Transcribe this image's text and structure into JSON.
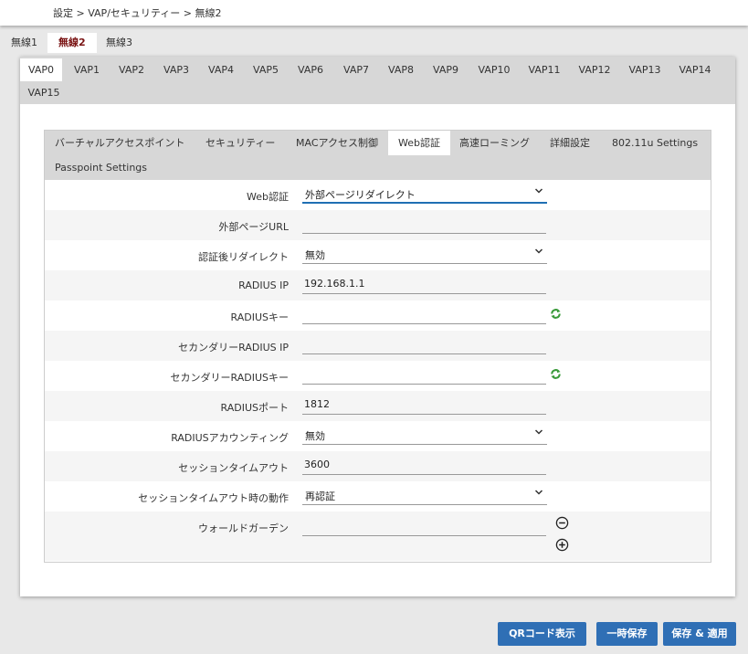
{
  "breadcrumb": "設定 > VAP/セキュリティー > 無線2",
  "radio_tabs": [
    "無線1",
    "無線2",
    "無線3"
  ],
  "active_radio": 1,
  "vap_tabs": [
    "VAP0",
    "VAP1",
    "VAP2",
    "VAP3",
    "VAP4",
    "VAP5",
    "VAP6",
    "VAP7",
    "VAP8",
    "VAP9",
    "VAP10",
    "VAP11",
    "VAP12",
    "VAP13",
    "VAP14",
    "VAP15"
  ],
  "active_vap": 0,
  "sub_tabs": [
    "バーチャルアクセスポイント",
    "セキュリティー",
    "MACアクセス制御",
    "Web認証",
    "高速ローミング",
    "詳細設定",
    "802.11u Settings",
    "Passpoint Settings"
  ],
  "active_sub_tab": 3,
  "form": {
    "web_auth": {
      "label": "Web認証",
      "value": "外部ページリダイレクト"
    },
    "external_url": {
      "label": "外部ページURL",
      "value": ""
    },
    "post_auth_redirect": {
      "label": "認証後リダイレクト",
      "value": "無効"
    },
    "radius_ip": {
      "label": "RADIUS IP",
      "value": "192.168.1.1"
    },
    "radius_key": {
      "label": "RADIUSキー",
      "value": ""
    },
    "secondary_radius_ip": {
      "label": "セカンダリーRADIUS IP",
      "value": ""
    },
    "secondary_radius_key": {
      "label": "セカンダリーRADIUSキー",
      "value": ""
    },
    "radius_port": {
      "label": "RADIUSポート",
      "value": "1812"
    },
    "radius_accounting": {
      "label": "RADIUSアカウンティング",
      "value": "無効"
    },
    "session_timeout": {
      "label": "セッションタイムアウト",
      "value": "3600"
    },
    "session_timeout_action": {
      "label": "セッションタイムアウト時の動作",
      "value": "再認証"
    },
    "walled_garden": {
      "label": "ウォールドガーデン",
      "value": ""
    }
  },
  "buttons": {
    "qr": "QRコード表示",
    "temp_save": "一時保存",
    "save_apply": "保存 & 適用"
  },
  "colors": {
    "accent": "#2f6fb5",
    "active_radio_text": "#7a1414",
    "tab_bar": "#d7d7d7",
    "generate_icon": "#3a9a3a"
  }
}
